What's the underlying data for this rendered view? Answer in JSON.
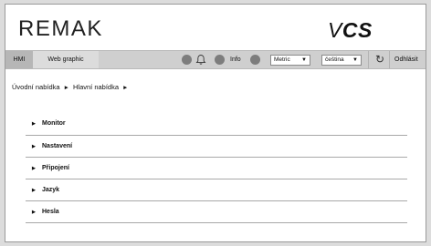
{
  "brand": {
    "logo_left": "REMAK",
    "logo_right_v": "V",
    "logo_right_cs": "CS"
  },
  "toolbar": {
    "tabs": [
      {
        "label": "HMI"
      },
      {
        "label": "Web graphic"
      }
    ],
    "info_label": "Info",
    "units_select": "Metric",
    "language_select": "čeština",
    "logout_label": "Odhlásit"
  },
  "breadcrumb": {
    "items": [
      "Úvodní nabídka",
      "Hlavní nabídka"
    ]
  },
  "menu": {
    "items": [
      {
        "label": "Monitor"
      },
      {
        "label": "Nastavení"
      },
      {
        "label": "Připojení"
      },
      {
        "label": "Jazyk"
      },
      {
        "label": "Hesla"
      }
    ]
  },
  "colors": {
    "toolbar_bg": "#cfcfcf",
    "active_tab": "#b6b6b6",
    "status_dot": "#7d7d7d"
  }
}
